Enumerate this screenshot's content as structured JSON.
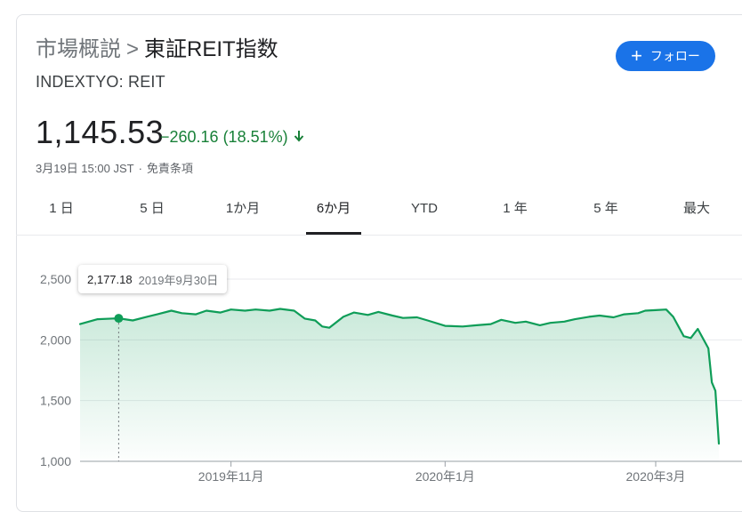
{
  "header": {
    "breadcrumb_parent": "市場概説",
    "breadcrumb_separator": ">",
    "title": "東証REIT指数",
    "ticker": "INDEXTYO: REIT",
    "follow_label": "フォロー"
  },
  "quote": {
    "price": "1,145.53",
    "change": "−260.16 (18.51%)",
    "direction": "down",
    "timestamp": "3月19日 15:00 JST",
    "timestamp_separator": "·",
    "disclaimer": "免責条項"
  },
  "range_tabs": [
    {
      "label": "1 日",
      "active": false
    },
    {
      "label": "5 日",
      "active": false
    },
    {
      "label": "1か月",
      "active": false
    },
    {
      "label": "6か月",
      "active": true
    },
    {
      "label": "YTD",
      "active": false
    },
    {
      "label": "1 年",
      "active": false
    },
    {
      "label": "5 年",
      "active": false
    },
    {
      "label": "最大",
      "active": false
    }
  ],
  "tooltip": {
    "value": "2,177.18",
    "date": "2019年9月30日"
  },
  "colors": {
    "line": "#0f9d58",
    "fill_top": "#0f9d58",
    "grid": "#e8eaed",
    "down": "#188038",
    "accent": "#1a73e8"
  },
  "chart_data": {
    "type": "area",
    "title": "",
    "xlabel": "",
    "ylabel": "",
    "ylim": [
      1000,
      2500
    ],
    "yticks": [
      1000,
      1500,
      2000,
      2500
    ],
    "ytick_labels": [
      "1,000",
      "1,500",
      "2,000",
      "2,500"
    ],
    "xticks": [
      {
        "date": "2019-11-01",
        "label": "2019年11月"
      },
      {
        "date": "2020-01-01",
        "label": "2020年1月"
      },
      {
        "date": "2020-03-01",
        "label": "2020年3月"
      }
    ],
    "grid": true,
    "highlight": {
      "date": "2019-09-30",
      "value": 2177.18
    },
    "series": [
      {
        "x": [
          "2019-09-19",
          "2019-09-24",
          "2019-09-30",
          "2019-10-04",
          "2019-10-08",
          "2019-10-11",
          "2019-10-15",
          "2019-10-18",
          "2019-10-22",
          "2019-10-25",
          "2019-10-29",
          "2019-11-01",
          "2019-11-05",
          "2019-11-08",
          "2019-11-12",
          "2019-11-15",
          "2019-11-19",
          "2019-11-22",
          "2019-11-25",
          "2019-11-27",
          "2019-11-29",
          "2019-12-03",
          "2019-12-06",
          "2019-12-10",
          "2019-12-13",
          "2019-12-17",
          "2019-12-20",
          "2019-12-24",
          "2019-12-27",
          "2020-01-01",
          "2020-01-06",
          "2020-01-10",
          "2020-01-14",
          "2020-01-17",
          "2020-01-21",
          "2020-01-24",
          "2020-01-28",
          "2020-01-31",
          "2020-02-04",
          "2020-02-07",
          "2020-02-11",
          "2020-02-14",
          "2020-02-18",
          "2020-02-21",
          "2020-02-25",
          "2020-02-27",
          "2020-03-01",
          "2020-03-04",
          "2020-03-06",
          "2020-03-09",
          "2020-03-11",
          "2020-03-13",
          "2020-03-16",
          "2020-03-17",
          "2020-03-18",
          "2020-03-19"
        ],
        "values": [
          2130,
          2170,
          2177.18,
          2160,
          2190,
          2210,
          2240,
          2220,
          2210,
          2240,
          2225,
          2250,
          2240,
          2250,
          2240,
          2255,
          2240,
          2175,
          2160,
          2110,
          2100,
          2190,
          2225,
          2205,
          2230,
          2200,
          2180,
          2185,
          2160,
          2115,
          2110,
          2120,
          2130,
          2165,
          2140,
          2150,
          2120,
          2140,
          2150,
          2170,
          2190,
          2200,
          2185,
          2210,
          2220,
          2240,
          2245,
          2250,
          2190,
          2030,
          2015,
          2090,
          1930,
          1650,
          1580,
          1145.53
        ]
      }
    ]
  }
}
